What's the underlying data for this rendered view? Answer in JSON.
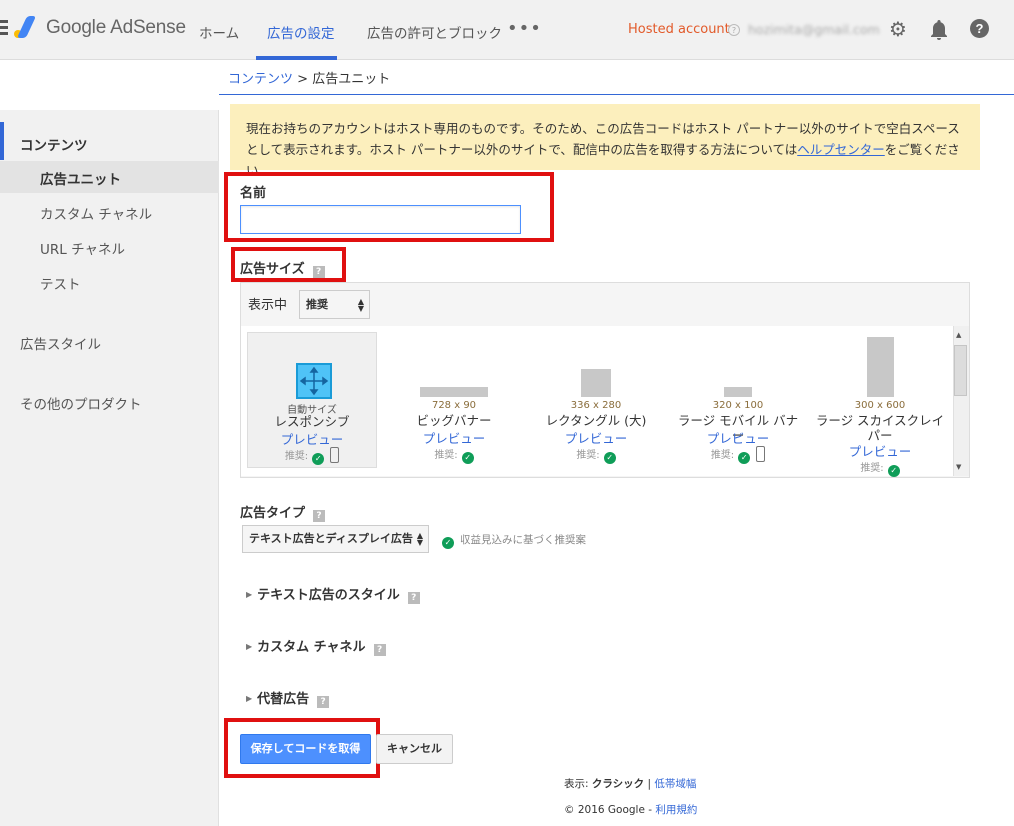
{
  "header": {
    "logo_text": "Google AdSense",
    "nav": [
      "ホーム",
      "広告の設定",
      "広告の許可とブロック"
    ],
    "more": "•••",
    "hosted_account": "Hosted account",
    "help_mark": "?",
    "email": "hozimita@gmail.com",
    "icons": [
      "gear-icon",
      "bell-icon",
      "help-icon"
    ]
  },
  "sidebar": {
    "section_contents": "コンテンツ",
    "items": [
      "広告ユニット",
      "カスタム チャネル",
      "URL チャネル",
      "テスト"
    ],
    "ad_style": "広告スタイル",
    "other_products": "その他のプロダクト"
  },
  "breadcrumb": {
    "link": "コンテンツ",
    "sep": " > ",
    "current": "広告ユニット"
  },
  "notice": {
    "text1": "現在お持ちのアカウントはホスト専用のものです。そのため、この広告コードはホスト パートナー以外のサイトで空白スペースとして表示されます。ホスト パートナー以外のサイトで、配信中の広告を取得する方法については",
    "link": "ヘルプセンター",
    "text2": "をご覧ください。"
  },
  "form": {
    "name_label": "名前",
    "name_value": "",
    "size_label": "広告サイズ",
    "show_label": "表示中",
    "show_select": "推奨",
    "ad_type_label": "広告タイプ",
    "ad_type_select": "テキスト広告とディスプレイ広告",
    "reco_note": "収益見込みに基づく推奨案",
    "text_style": "テキスト広告のスタイル",
    "custom_channel": "カスタム チャネル",
    "alt_ads": "代替広告",
    "save_button": "保存してコードを取得",
    "cancel_button": "キャンセル"
  },
  "sizes": [
    {
      "dim": "自動サイズ",
      "title": "レスポンシブ",
      "preview": "プレビュー",
      "rec": "推奨:",
      "mobile": true
    },
    {
      "dim": "728 x 90",
      "title": "ビッグバナー",
      "preview": "プレビュー",
      "rec": "推奨:",
      "mobile": false
    },
    {
      "dim": "336 x 280",
      "title": "レクタングル (大)",
      "preview": "プレビュー",
      "rec": "推奨:",
      "mobile": false
    },
    {
      "dim": "320 x 100",
      "title": "ラージ モバイル バナー",
      "preview": "プレビュー",
      "rec": "推奨:",
      "mobile": true
    },
    {
      "dim": "300 x 600",
      "title": "ラージ スカイスクレイパー",
      "preview": "プレビュー",
      "rec": "推奨:",
      "mobile": false
    }
  ],
  "footer": {
    "display_prefix": "表示: ",
    "classic": "クラシック",
    "pipe": " | ",
    "low_bandwidth": "低帯域幅",
    "copyright": "© 2016 Google - ",
    "terms": "利用規約"
  }
}
